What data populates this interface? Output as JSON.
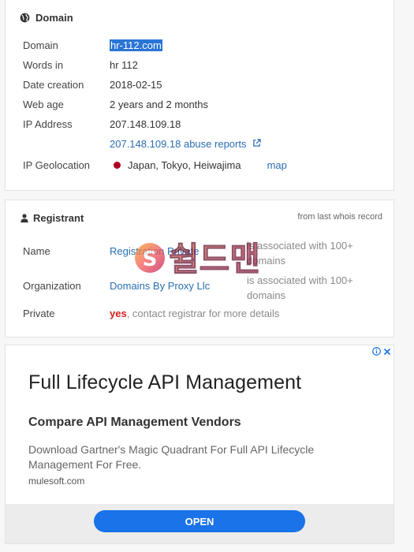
{
  "domain_section": {
    "title": "Domain",
    "rows": {
      "domain": {
        "label": "Domain",
        "value": "hr-112.com"
      },
      "words": {
        "label": "Words in",
        "value": "hr 112"
      },
      "date": {
        "label": "Date creation",
        "value": "2018-02-15"
      },
      "age": {
        "label": "Web age",
        "value": "2 years and 2 months"
      },
      "ip": {
        "label": "IP Address",
        "value": "207.148.109.18"
      },
      "abuse": {
        "value": "207.148.109.18 abuse reports"
      },
      "geo": {
        "label": "IP Geolocation",
        "value": "Japan, Tokyo, Heiwajima",
        "map": "map"
      }
    }
  },
  "registrant_section": {
    "title": "Registrant",
    "note": "from last whois record",
    "name": {
      "label": "Name",
      "value": "Registration Private",
      "extra": "is associated with 100+ domains"
    },
    "org": {
      "label": "Organization",
      "value": "Domains By Proxy Llc",
      "extra": "is associated with 100+ domains"
    },
    "private": {
      "label": "Private",
      "yes": "yes",
      "rest": ", contact registrar for more details"
    }
  },
  "ad": {
    "title": "Full Lifecycle API Management",
    "subtitle": "Compare API Management Vendors",
    "description": "Download Gartner's Magic Quadrant For Full API Lifecycle Management For Free.",
    "host": "mulesoft.com",
    "button": "OPEN"
  },
  "watermark_text": "쉴드맨",
  "colors": {
    "link": "#2a6eb3",
    "highlight": "#2b75d6",
    "button": "#1a73e8",
    "flag": "#b00020",
    "yes": "#d51f1f"
  }
}
